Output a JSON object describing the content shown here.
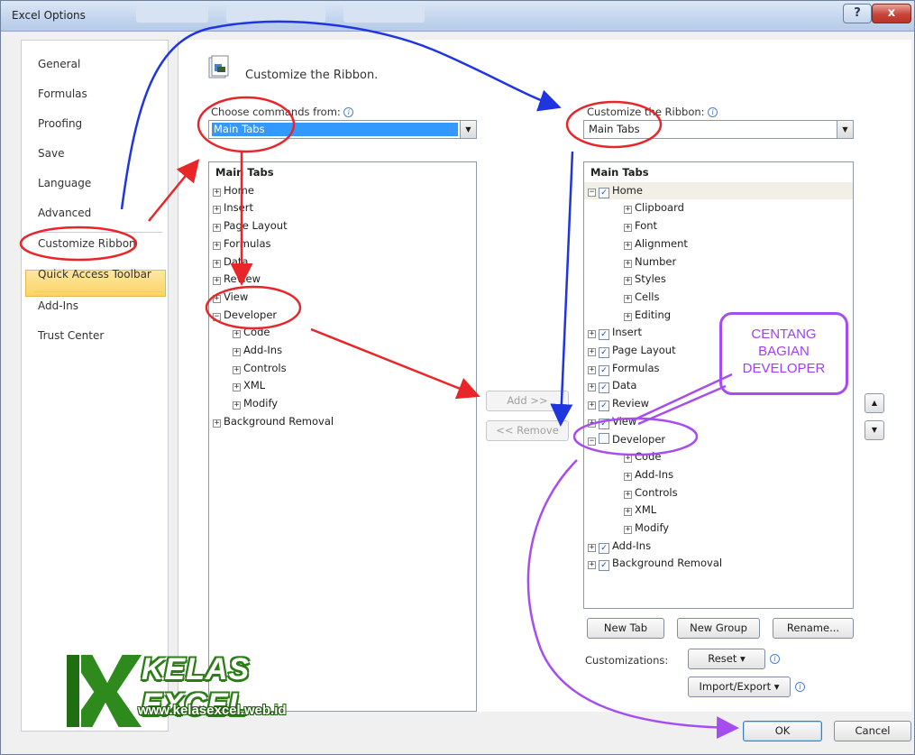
{
  "window": {
    "title": "Excel Options",
    "help_label": "?",
    "close_label": "x"
  },
  "nav": {
    "items": [
      {
        "label": "General"
      },
      {
        "label": "Formulas"
      },
      {
        "label": "Proofing"
      },
      {
        "label": "Save"
      },
      {
        "label": "Language"
      },
      {
        "label": "Advanced"
      },
      {
        "label": "Customize Ribbon"
      },
      {
        "label": "Quick Access Toolbar"
      },
      {
        "label": "Add-Ins"
      },
      {
        "label": "Trust Center"
      }
    ],
    "active": "Customize Ribbon"
  },
  "page": {
    "title": "Customize the Ribbon."
  },
  "left": {
    "label": "Choose commands from:",
    "combo_value": "Main Tabs",
    "list": [
      {
        "text": "Main Tabs",
        "bold": true
      },
      {
        "text": "Home",
        "expander": "+"
      },
      {
        "text": "Insert",
        "expander": "+"
      },
      {
        "text": "Page Layout",
        "expander": "+"
      },
      {
        "text": "Formulas",
        "expander": "+"
      },
      {
        "text": "Data",
        "expander": "+"
      },
      {
        "text": "Review",
        "expander": "+"
      },
      {
        "text": "View",
        "expander": "+"
      },
      {
        "text": "Developer",
        "expander": "−"
      },
      {
        "text": "Code",
        "expander": "+",
        "indent": 1
      },
      {
        "text": "Add-Ins",
        "expander": "+",
        "indent": 1
      },
      {
        "text": "Controls",
        "expander": "+",
        "indent": 1
      },
      {
        "text": "XML",
        "expander": "+",
        "indent": 1
      },
      {
        "text": "Modify",
        "expander": "+",
        "indent": 1
      },
      {
        "text": "Background Removal",
        "expander": "+"
      }
    ]
  },
  "middle": {
    "add_label": "Add >>",
    "remove_label": "<< Remove"
  },
  "right": {
    "label": "Customize the Ribbon:",
    "combo_value": "Main Tabs",
    "list": [
      {
        "text": "Main Tabs",
        "bold": true
      },
      {
        "text": "Home",
        "expander": "−",
        "checked": true,
        "highlight": true
      },
      {
        "text": "Clipboard",
        "expander": "+",
        "indent": 1
      },
      {
        "text": "Font",
        "expander": "+",
        "indent": 1
      },
      {
        "text": "Alignment",
        "expander": "+",
        "indent": 1
      },
      {
        "text": "Number",
        "expander": "+",
        "indent": 1
      },
      {
        "text": "Styles",
        "expander": "+",
        "indent": 1
      },
      {
        "text": "Cells",
        "expander": "+",
        "indent": 1
      },
      {
        "text": "Editing",
        "expander": "+",
        "indent": 1
      },
      {
        "text": "Insert",
        "expander": "+",
        "checked": true
      },
      {
        "text": "Page Layout",
        "expander": "+",
        "checked": true
      },
      {
        "text": "Formulas",
        "expander": "+",
        "checked": true
      },
      {
        "text": "Data",
        "expander": "+",
        "checked": true
      },
      {
        "text": "Review",
        "expander": "+",
        "checked": true
      },
      {
        "text": "View",
        "expander": "+",
        "checked": true
      },
      {
        "text": "Developer",
        "expander": "−",
        "checked": false
      },
      {
        "text": "Code",
        "expander": "+",
        "indent": 1
      },
      {
        "text": "Add-Ins",
        "expander": "+",
        "indent": 1
      },
      {
        "text": "Controls",
        "expander": "+",
        "indent": 1
      },
      {
        "text": "XML",
        "expander": "+",
        "indent": 1
      },
      {
        "text": "Modify",
        "expander": "+",
        "indent": 1
      },
      {
        "text": "Add-Ins",
        "expander": "+",
        "checked": true
      },
      {
        "text": "Background Removal",
        "expander": "+",
        "checked": true
      }
    ],
    "new_tab_label": "New Tab",
    "new_group_label": "New Group",
    "rename_label": "Rename...",
    "customizations_label": "Customizations:",
    "reset_label": "Reset ▾",
    "import_export_label": "Import/Export ▾"
  },
  "footer": {
    "ok_label": "OK",
    "cancel_label": "Cancel"
  },
  "callout": {
    "line1": "CENTANG",
    "line2": "BAGIAN",
    "line3": "DEVELOPER"
  },
  "watermark": {
    "title": "KELAS EXCEL",
    "url": "www.kelasexcel.web.id"
  },
  "colors": {
    "annotation_red": "#e8262a",
    "annotation_blue": "#1f35e0",
    "annotation_purple": "#a64df0",
    "nav_active": "#fbd463",
    "selection": "#3399ff"
  }
}
